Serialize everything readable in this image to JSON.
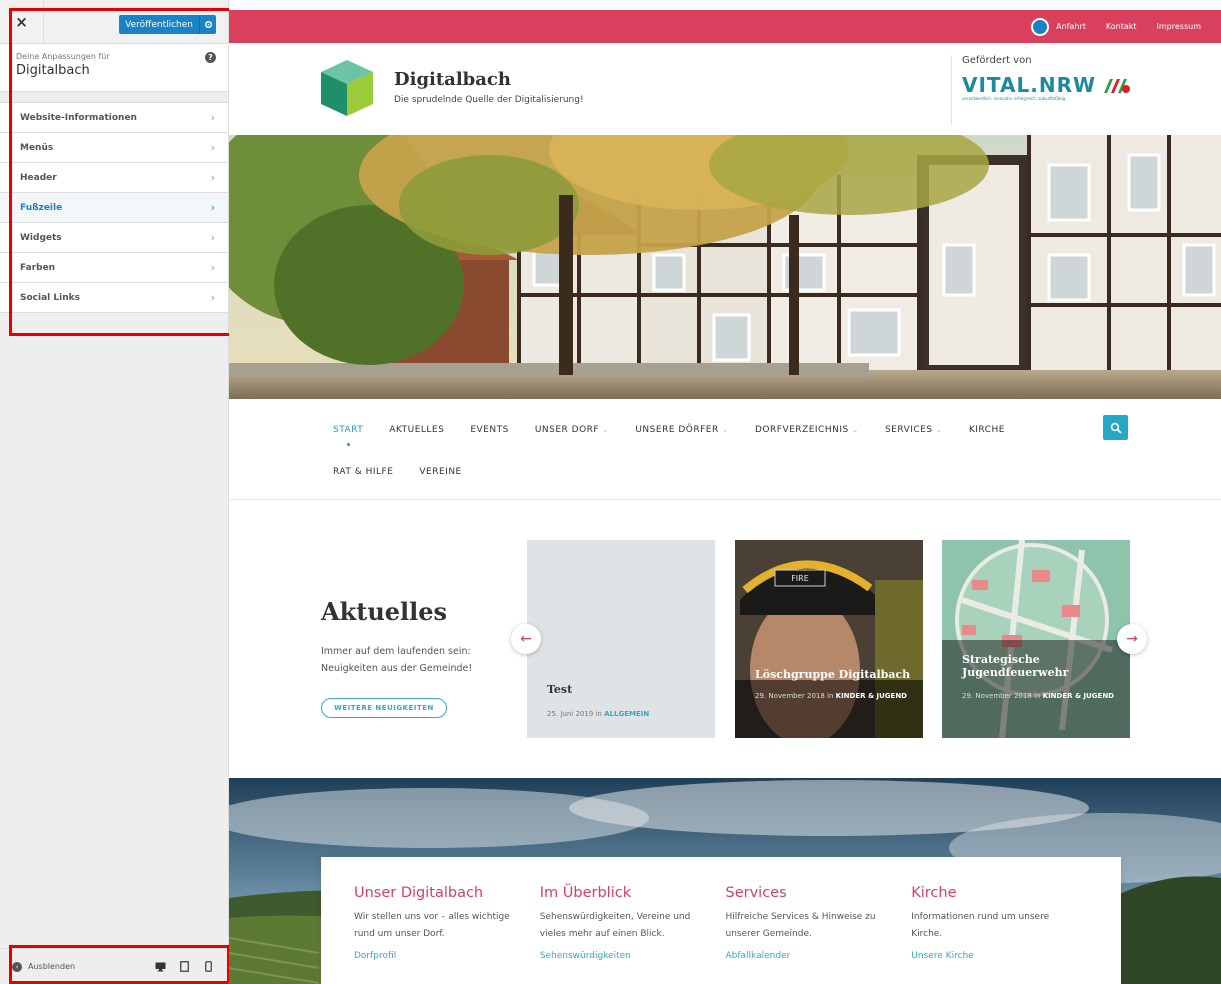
{
  "customizer": {
    "close_glyph": "×",
    "publish_label": "Veröffentlichen",
    "info_label": "Deine Anpassungen für",
    "site_name": "Digitalbach",
    "help_glyph": "?",
    "menu": [
      {
        "label": "Website-Informationen",
        "active": false
      },
      {
        "label": "Menüs",
        "active": false
      },
      {
        "label": "Header",
        "active": false
      },
      {
        "label": "Fußzeile",
        "active": true
      },
      {
        "label": "Widgets",
        "active": false
      },
      {
        "label": "Farben",
        "active": false
      },
      {
        "label": "Social Links",
        "active": false
      }
    ],
    "hide_label": "Ausblenden",
    "devices": [
      "desktop-icon",
      "tablet-icon",
      "mobile-icon"
    ],
    "accent_color": "#1a82c6",
    "highlight_color": "#e60000"
  },
  "site": {
    "topbar_links": [
      "Anfahrt",
      "Kontakt",
      "Impressum"
    ],
    "title": "Digitalbach",
    "tagline": "Die sprudelnde Quelle der Digitalisierung!",
    "sponsor_label": "Gefördert von",
    "sponsor_logo_text": "VITAL.NRW",
    "sponsor_logo_claim": "verantwortlich. innovativ. erfolgreich. zukunftsfähig",
    "brand_color": "#d9405e",
    "link_color": "#3aa6c1",
    "nav": [
      {
        "label": "START",
        "active": true,
        "has_caret": false
      },
      {
        "label": "AKTUELLES",
        "active": false,
        "has_caret": false
      },
      {
        "label": "EVENTS",
        "active": false,
        "has_caret": false
      },
      {
        "label": "UNSER DORF",
        "active": false,
        "has_caret": true
      },
      {
        "label": "UNSERE DÖRFER",
        "active": false,
        "has_caret": true
      },
      {
        "label": "DORFVERZEICHNIS",
        "active": false,
        "has_caret": true
      },
      {
        "label": "SERVICES",
        "active": false,
        "has_caret": true
      },
      {
        "label": "KIRCHE",
        "active": false,
        "has_caret": false
      },
      {
        "label": "RAT & HILFE",
        "active": false,
        "has_caret": false
      },
      {
        "label": "VEREINE",
        "active": false,
        "has_caret": false
      }
    ],
    "news": {
      "title": "Aktuelles",
      "description": "Immer auf dem laufenden sein: Neuigkeiten aus der Gemeinde!",
      "more_button": "WEITERE NEUIGKEITEN",
      "prev_arrow": "←",
      "next_arrow": "→",
      "cards": [
        {
          "title": "Test",
          "date": "25. Juni 2019 in ",
          "category": "ALLGEMEIN"
        },
        {
          "title": "Löschgruppe Digitalbach",
          "date": "29. November 2018 in ",
          "category": "KINDER & JUGEND",
          "helmet_text": "FIRE"
        },
        {
          "title": "Strategische Jugendfeuerwehr",
          "date": "29. November 2018 in ",
          "category": "KINDER & JUGEND"
        }
      ]
    },
    "info_columns": [
      {
        "heading": "Unser Digitalbach",
        "text": "Wir stellen uns vor – alles wichtige rund um unser Dorf.",
        "link": "Dorfprofil"
      },
      {
        "heading": "Im Überblick",
        "text": "Sehenswürdigkeiten, Vereine und vieles mehr auf einen Blick.",
        "link": "Sehenswürdigkeiten"
      },
      {
        "heading": "Services",
        "text": "Hilfreiche Services & Hinweise zu unserer Gemeinde.",
        "link": "Abfallkalender"
      },
      {
        "heading": "Kirche",
        "text": "Informationen rund um unsere Kirche.",
        "link": "Unsere Kirche"
      }
    ]
  }
}
